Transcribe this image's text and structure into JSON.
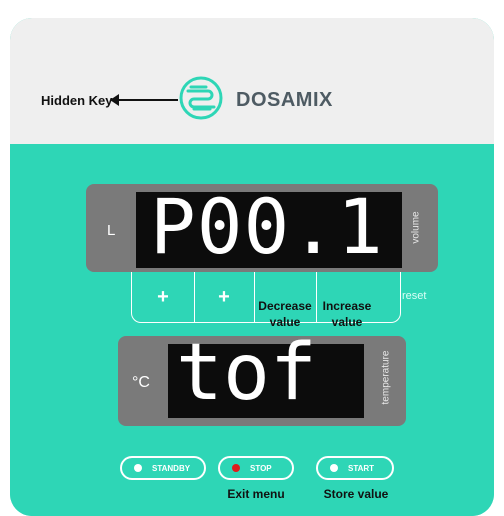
{
  "header": {
    "hidden_key_label": "Hidden Key",
    "brand": "DOSAMIX",
    "logo_icon": "dosamix-logo-icon"
  },
  "display_top": {
    "unit": "L",
    "value": "P00.1",
    "side_label": "volume"
  },
  "keys": {
    "k1": "+",
    "k2": "+",
    "k3": "Decrease value",
    "k4": "Increase value",
    "reset": "reset"
  },
  "display_bottom": {
    "unit": "°C",
    "value": "tof",
    "side_label": "temperature"
  },
  "buttons": {
    "standby": "STANDBY",
    "stop": "STOP",
    "start": "START"
  },
  "button_notes": {
    "exit": "Exit menu",
    "store": "Store value"
  },
  "colors": {
    "teal": "#2ed6b6",
    "header_bg": "#efefef",
    "panel": "#7a7a7a",
    "screen": "#0c0c0c",
    "stop_led": "#e01b1b"
  }
}
